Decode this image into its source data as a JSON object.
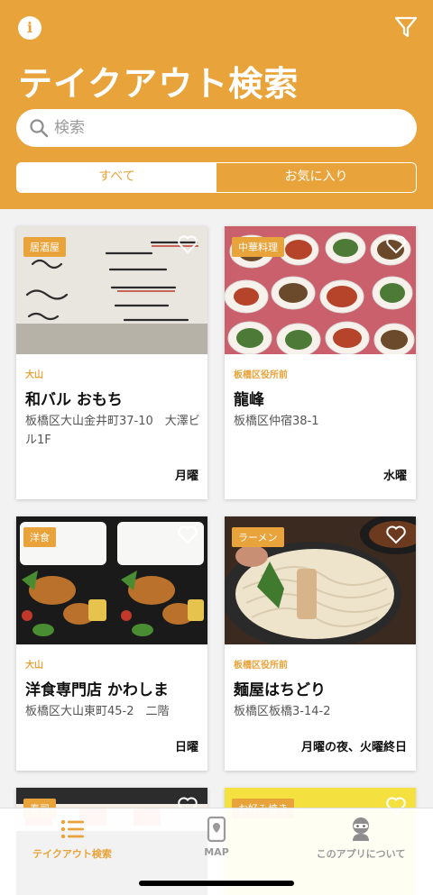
{
  "header": {
    "title": "テイクアウト検索",
    "search_placeholder": "検索",
    "tabs": [
      "すべて",
      "お気に入り"
    ]
  },
  "colors": {
    "accent": "#e8a33a",
    "tab_inactive": "#9a9a9a"
  },
  "cards": [
    {
      "badge": "居酒屋",
      "area": "大山",
      "name": "和バル おもち",
      "address": "板橋区大山金井町37-10　大澤ビル1F",
      "closed": "月曜"
    },
    {
      "badge": "中華料理",
      "area": "板橋区役所前",
      "name": "龍峰",
      "address": "板橋区仲宿38-1",
      "closed": "水曜"
    },
    {
      "badge": "洋食",
      "area": "大山",
      "name": "洋食専門店 かわしま",
      "address": "板橋区大山東町45-2　二階",
      "closed": "日曜"
    },
    {
      "badge": "ラーメン",
      "area": "板橋区役所前",
      "name": "麺屋はちどり",
      "address": "板橋区板橋3-14-2",
      "closed": "月曜の夜、火曜終日"
    },
    {
      "badge": "寿司"
    },
    {
      "badge": "お好み焼き"
    }
  ],
  "tabbar": {
    "items": [
      {
        "label": "テイクアウト検索",
        "icon": "list-icon",
        "active": true
      },
      {
        "label": "MAP",
        "icon": "map-icon",
        "active": false
      },
      {
        "label": "このアプリについて",
        "icon": "ninja-icon",
        "active": false
      }
    ]
  }
}
